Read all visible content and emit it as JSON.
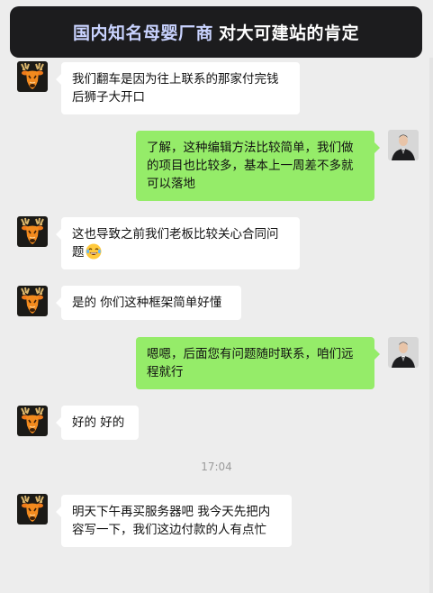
{
  "banner": {
    "highlight": "国内知名母婴厂商",
    "rest": "对大可建站的肯定"
  },
  "messages": [
    {
      "side": "received",
      "text": "我们翻车是因为往上联系的那家付完钱后狮子大开口"
    },
    {
      "side": "sent",
      "text": "了解，这种编辑方法比较简单，我们做的项目也比较多，基本上一周差不多就可以落地"
    },
    {
      "side": "received",
      "text": "这也导致之前我们老板比较关心合同问题",
      "emoji": "laughing-crying-emoji"
    },
    {
      "side": "received",
      "text": "是的 你们这种框架简单好懂"
    },
    {
      "side": "sent",
      "text": "嗯嗯，后面您有问题随时联系，咱们远程就行"
    },
    {
      "side": "received",
      "text": "好的 好的"
    },
    {
      "side": "received",
      "text": "明天下午再买服务器吧 我今天先把内容写一下，我们这边付款的人有点忙"
    }
  ],
  "timestamp": "17:04",
  "colors": {
    "background": "#ededed",
    "sent_bubble": "#95ec69",
    "received_bubble": "#ffffff",
    "banner_bg": "#1c1c1e",
    "banner_highlight": "#c9d3ff"
  },
  "icons": {
    "received_avatar": "deer-avatar-icon",
    "sent_avatar": "man-in-suit-avatar-icon"
  }
}
